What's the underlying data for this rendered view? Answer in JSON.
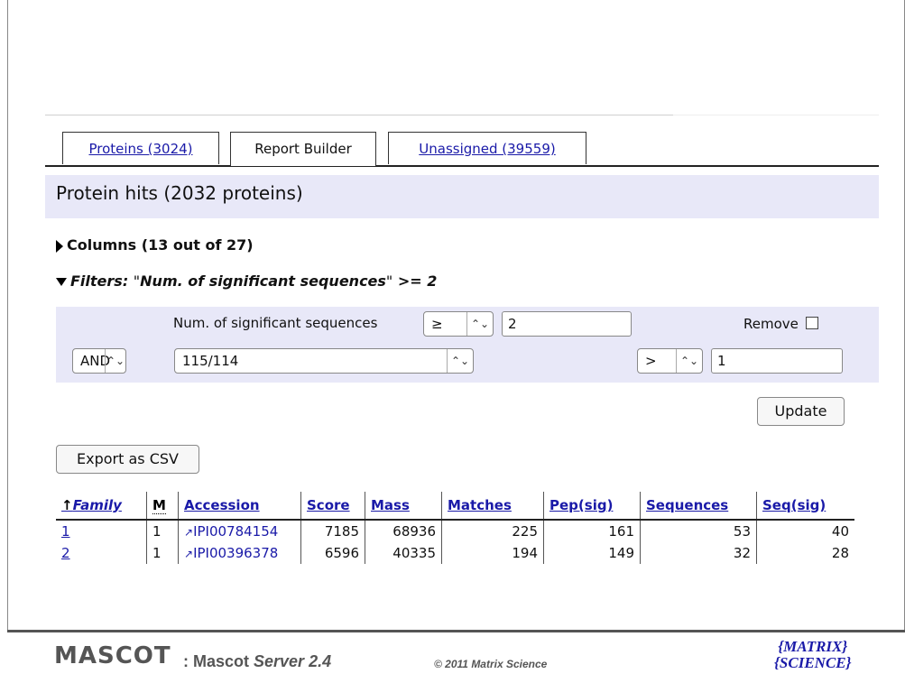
{
  "tabs": [
    {
      "label": "Proteins (3024)"
    },
    {
      "label": "Report Builder"
    },
    {
      "label": "Unassigned (39559)"
    }
  ],
  "hits_title": "Protein hits (2032 proteins)",
  "columns_toggle": "Columns (13 out of 27)",
  "filters_summary": {
    "prefix": "Filters:",
    "field": "\"Num. of significant sequences\"",
    "op": ">=",
    "value": "2"
  },
  "filter_row1": {
    "label": "Num. of significant sequences",
    "operator": "≥",
    "value": "2",
    "remove_label": "Remove"
  },
  "filter_row2": {
    "logic": "AND",
    "field": "115/114",
    "operator": ">",
    "value": "1"
  },
  "update_label": "Update",
  "export_label": "Export as CSV",
  "table": {
    "headers": [
      "Family",
      "M",
      "Accession",
      "Score",
      "Mass",
      "Matches",
      "Pep(sig)",
      "Sequences",
      "Seq(sig)"
    ],
    "rows": [
      [
        "1",
        "1",
        "IPI00784154",
        "7185",
        "68936",
        "225",
        "161",
        "53",
        "40"
      ],
      [
        "2",
        "1",
        "IPI00396378",
        "6596",
        "40335",
        "194",
        "149",
        "32",
        "28"
      ]
    ]
  },
  "footer": {
    "logo": "MASCOT",
    "text_prefix": ": Mascot ",
    "text_italic": "Server 2.4",
    "copyright": "© 2011 Matrix Science",
    "ms_logo_line1": "MATRIX",
    "ms_logo_line2": "SCIENCE"
  }
}
